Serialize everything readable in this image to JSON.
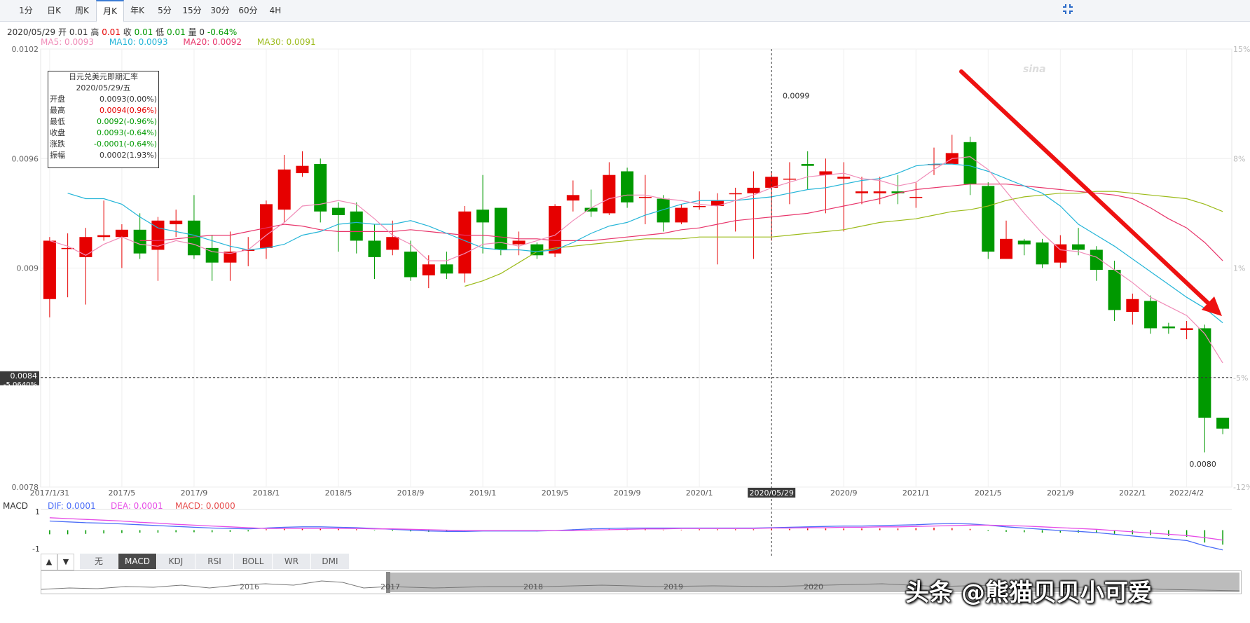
{
  "tabs": [
    "1分",
    "日K",
    "周K",
    "月K",
    "年K",
    "5分",
    "15分",
    "30分",
    "60分",
    "4H"
  ],
  "active_tab": "月K",
  "info": {
    "date": "2020/05/29",
    "open_label": "开",
    "open": "0.01",
    "high_label": "高",
    "high": "0.01",
    "close_label": "收",
    "close": "0.01",
    "low_label": "低",
    "low": "0.01",
    "vol_label": "量",
    "vol": "0",
    "change": "-0.64%"
  },
  "ma_legend": {
    "ma5": "MA5: 0.0093",
    "ma10": "MA10: 0.0093",
    "ma20": "MA20: 0.0092",
    "ma30": "MA30: 0.0091",
    "colors": {
      "ma5": "#f08cb8",
      "ma10": "#24b5d8",
      "ma20": "#e8356b",
      "ma30": "#9cbb1a"
    }
  },
  "tooltip": {
    "title": "日元兑美元即期汇率",
    "date": "2020/05/29/五",
    "rows": [
      {
        "k": "开盘",
        "v": "0.0093(0.00%)",
        "c": "#333333"
      },
      {
        "k": "最高",
        "v": "0.0094(0.96%)",
        "c": "#e60000"
      },
      {
        "k": "最低",
        "v": "0.0092(-0.96%)",
        "c": "#009900"
      },
      {
        "k": "收盘",
        "v": "0.0093(-0.64%)",
        "c": "#009900"
      },
      {
        "k": "涨跌",
        "v": "-0.0001(-0.64%)",
        "c": "#009900"
      },
      {
        "k": "振幅",
        "v": "0.0002(1.93%)",
        "c": "#333333"
      }
    ]
  },
  "crosshair": {
    "price": "0.0084",
    "pct": "-5.0640%",
    "date": "2020/05/29"
  },
  "annotations": {
    "max": "0.0099",
    "min": "0.0080"
  },
  "macd_legend": {
    "label": "MACD",
    "dif": "DIF: 0.0001",
    "dea": "DEA: 0.0001",
    "macd": "MACD: 0.0000",
    "top": "1",
    "bottom": "-1"
  },
  "indicator_tabs": [
    "无",
    "MACD",
    "KDJ",
    "RSI",
    "BOLL",
    "WR",
    "DMI"
  ],
  "active_indicator": "MACD",
  "arrows": {
    "up": "▲",
    "down": "▼"
  },
  "navigator_years": [
    "2016",
    "2017",
    "2018",
    "2019",
    "2020"
  ],
  "watermark": "头条 @熊猫贝贝小可爱",
  "chart_data": {
    "type": "candlestick",
    "title": "日元兑美元即期汇率",
    "ylim": [
      0.0078,
      0.0102
    ],
    "y_ticks": [
      "0.0102",
      "0.0096",
      "0.009",
      "0.0078"
    ],
    "pct_ticks": [
      "15%",
      "8%",
      "1%",
      "-5%",
      "-12%"
    ],
    "x_ticks": [
      "2017/1/31",
      "2017/5",
      "2017/9",
      "2018/1",
      "2018/5",
      "2018/9",
      "2019/1",
      "2019/5",
      "2019/9",
      "2020/1",
      "2020/9",
      "2021/1",
      "2021/5",
      "2021/9",
      "2022/1",
      "2022/4/2"
    ],
    "x_tick_index": [
      0,
      4,
      8,
      12,
      16,
      20,
      24,
      28,
      32,
      36,
      44,
      48,
      52,
      56,
      60,
      63
    ],
    "candles": [
      [
        0.00883,
        0.00915,
        0.00917,
        0.00873
      ],
      [
        0.00911,
        0.00911,
        0.00919,
        0.00884
      ],
      [
        0.00906,
        0.00917,
        0.00922,
        0.0088
      ],
      [
        0.00917,
        0.00918,
        0.00937,
        0.00915
      ],
      [
        0.00917,
        0.00921,
        0.00924,
        0.009
      ],
      [
        0.00921,
        0.00908,
        0.0093,
        0.00905
      ],
      [
        0.0091,
        0.00926,
        0.00928,
        0.00893
      ],
      [
        0.00924,
        0.00926,
        0.00932,
        0.00917
      ],
      [
        0.00926,
        0.00907,
        0.0094,
        0.00905
      ],
      [
        0.00911,
        0.00903,
        0.00918,
        0.00893
      ],
      [
        0.00903,
        0.00909,
        0.0092,
        0.00893
      ],
      [
        0.0091,
        0.0091,
        0.00917,
        0.00901
      ],
      [
        0.00911,
        0.00935,
        0.00937,
        0.00905
      ],
      [
        0.00932,
        0.00954,
        0.00962,
        0.00925
      ],
      [
        0.00952,
        0.00956,
        0.00964,
        0.0095
      ],
      [
        0.00957,
        0.00931,
        0.0096,
        0.00925
      ],
      [
        0.00933,
        0.00929,
        0.00936,
        0.00909
      ],
      [
        0.00931,
        0.00915,
        0.00936,
        0.00908
      ],
      [
        0.00915,
        0.00906,
        0.00924,
        0.00894
      ],
      [
        0.0091,
        0.00917,
        0.00926,
        0.00907
      ],
      [
        0.00909,
        0.00895,
        0.00915,
        0.00893
      ],
      [
        0.00896,
        0.00902,
        0.00907,
        0.00889
      ],
      [
        0.00902,
        0.00897,
        0.00909,
        0.00894
      ],
      [
        0.00897,
        0.00931,
        0.00934,
        0.00892
      ],
      [
        0.00932,
        0.00925,
        0.00951,
        0.00908
      ],
      [
        0.00933,
        0.0091,
        0.00933,
        0.00907
      ],
      [
        0.00913,
        0.00915,
        0.0092,
        0.00907
      ],
      [
        0.00913,
        0.00907,
        0.00914,
        0.00905
      ],
      [
        0.00908,
        0.00934,
        0.00935,
        0.00906
      ],
      [
        0.00937,
        0.0094,
        0.00948,
        0.00931
      ],
      [
        0.00933,
        0.00931,
        0.00943,
        0.00928
      ],
      [
        0.0093,
        0.00951,
        0.00958,
        0.00929
      ],
      [
        0.00953,
        0.00936,
        0.00955,
        0.00933
      ],
      [
        0.00939,
        0.00939,
        0.00951,
        0.00924
      ],
      [
        0.00938,
        0.00925,
        0.0094,
        0.0092
      ],
      [
        0.00925,
        0.00933,
        0.00935,
        0.00924
      ],
      [
        0.00934,
        0.00934,
        0.00942,
        0.00932
      ],
      [
        0.00934,
        0.00937,
        0.00941,
        0.00902
      ],
      [
        0.00941,
        0.00941,
        0.00944,
        0.0092
      ],
      [
        0.00941,
        0.00944,
        0.00953,
        0.00905
      ],
      [
        0.00944,
        0.0095,
        0.00953,
        0.00915
      ],
      [
        0.00949,
        0.00949,
        0.00958,
        0.00935
      ],
      [
        0.00957,
        0.00956,
        0.00964,
        0.00943
      ],
      [
        0.00951,
        0.00953,
        0.0096,
        0.0093
      ],
      [
        0.00949,
        0.0095,
        0.00958,
        0.0092
      ],
      [
        0.00941,
        0.00942,
        0.0095,
        0.00935
      ],
      [
        0.00941,
        0.00942,
        0.0095,
        0.00935
      ],
      [
        0.00942,
        0.00941,
        0.00951,
        0.00935
      ],
      [
        0.00939,
        0.00939,
        0.00947,
        0.00933
      ],
      [
        0.00957,
        0.00957,
        0.00966,
        0.00951
      ],
      [
        0.00957,
        0.00963,
        0.00973,
        0.00958
      ],
      [
        0.00969,
        0.00946,
        0.00972,
        0.0094
      ],
      [
        0.00945,
        0.00909,
        0.00947,
        0.00905
      ],
      [
        0.00905,
        0.00916,
        0.00926,
        0.00905
      ],
      [
        0.00915,
        0.00913,
        0.00916,
        0.00907
      ],
      [
        0.00914,
        0.00902,
        0.00916,
        0.009
      ],
      [
        0.00903,
        0.00913,
        0.00918,
        0.009
      ],
      [
        0.00913,
        0.0091,
        0.00922,
        0.00907
      ],
      [
        0.0091,
        0.00899,
        0.00912,
        0.00893
      ],
      [
        0.00899,
        0.00877,
        0.00904,
        0.00871
      ],
      [
        0.00876,
        0.00883,
        0.00886,
        0.00869
      ],
      [
        0.00882,
        0.00867,
        0.00885,
        0.00864
      ],
      [
        0.00868,
        0.00867,
        0.0087,
        0.00864
      ],
      [
        0.00866,
        0.00867,
        0.00871,
        0.00861
      ],
      [
        0.00867,
        0.00818,
        0.00869,
        0.00799
      ],
      [
        0.00818,
        0.00812,
        0.00818,
        0.00809
      ]
    ],
    "note": "candles are [open, close, high, low] for each month",
    "ma5": [
      0.00915,
      0.00912,
      0.00907,
      0.00913,
      0.00917,
      0.00913,
      0.00912,
      0.00915,
      0.00913,
      0.00909,
      0.00908,
      0.0091,
      0.00918,
      0.00925,
      0.00934,
      0.00935,
      0.00937,
      0.00935,
      0.00927,
      0.00918,
      0.00913,
      0.00904,
      0.00904,
      0.00908,
      0.00913,
      0.00914,
      0.00912,
      0.00915,
      0.00918,
      0.00926,
      0.00933,
      0.00938,
      0.0094,
      0.0094,
      0.00938,
      0.00937,
      0.00935,
      0.00934,
      0.00937,
      0.0094,
      0.00944,
      0.00947,
      0.0095,
      0.00951,
      0.00952,
      0.00949,
      0.00948,
      0.00945,
      0.00947,
      0.00954,
      0.0096,
      0.00961,
      0.00954,
      0.00942,
      0.0093,
      0.00919,
      0.0091,
      0.00909,
      0.00906,
      0.00899,
      0.00892,
      0.00884,
      0.00879,
      0.00874,
      0.00864,
      0.00848
    ],
    "ma10": [
      0.00941,
      0.00938,
      0.00938,
      0.00935,
      0.00928,
      0.00922,
      0.0092,
      0.00918,
      0.00915,
      0.00912,
      0.0091,
      0.00911,
      0.00913,
      0.00918,
      0.0092,
      0.00924,
      0.00925,
      0.00924,
      0.00924,
      0.00926,
      0.00923,
      0.00919,
      0.00915,
      0.00911,
      0.0091,
      0.0091,
      0.00909,
      0.0091,
      0.00914,
      0.00919,
      0.00923,
      0.00925,
      0.00929,
      0.00932,
      0.00935,
      0.00937,
      0.00937,
      0.00937,
      0.00938,
      0.00939,
      0.00941,
      0.00943,
      0.00944,
      0.00946,
      0.00948,
      0.00949,
      0.00952,
      0.00956,
      0.00957,
      0.00957,
      0.00956,
      0.00953,
      0.00949,
      0.00945,
      0.00941,
      0.00934,
      0.00924,
      0.00918,
      0.00912,
      0.00905,
      0.00898,
      0.00891,
      0.00884,
      0.00878,
      0.0087
    ],
    "ma20": [
      0.00915,
      0.00915,
      0.00916,
      0.00917,
      0.00918,
      0.00918,
      0.0092,
      0.00922,
      0.00924,
      0.00923,
      0.00921,
      0.0092,
      0.0092,
      0.0092,
      0.0092,
      0.00921,
      0.0092,
      0.00919,
      0.00918,
      0.00918,
      0.00917,
      0.00916,
      0.00916,
      0.00915,
      0.00915,
      0.00915,
      0.00916,
      0.00917,
      0.00918,
      0.00919,
      0.00921,
      0.00922,
      0.00924,
      0.00926,
      0.00927,
      0.00928,
      0.00929,
      0.0093,
      0.00932,
      0.00934,
      0.00936,
      0.00938,
      0.00941,
      0.00943,
      0.00944,
      0.00945,
      0.00946,
      0.00946,
      0.00946,
      0.00945,
      0.00944,
      0.00943,
      0.00942,
      0.00941,
      0.0094,
      0.00938,
      0.00933,
      0.00927,
      0.00922,
      0.00914,
      0.00904
    ],
    "ma30": [
      0.0089,
      0.00893,
      0.00897,
      0.00903,
      0.00909,
      0.00911,
      0.00912,
      0.00913,
      0.00914,
      0.00915,
      0.00916,
      0.00916,
      0.00916,
      0.00917,
      0.00917,
      0.00917,
      0.00917,
      0.00917,
      0.00918,
      0.00919,
      0.0092,
      0.00921,
      0.00923,
      0.00925,
      0.00926,
      0.00927,
      0.00929,
      0.00931,
      0.00932,
      0.00934,
      0.00937,
      0.00939,
      0.0094,
      0.00941,
      0.00941,
      0.00942,
      0.00942,
      0.00941,
      0.0094,
      0.00939,
      0.00938,
      0.00935,
      0.00931
    ],
    "macd_bars": [
      -0.1,
      -0.1,
      -0.09,
      -0.08,
      -0.07,
      -0.06,
      -0.06,
      -0.05,
      -0.05,
      -0.05,
      -0.04,
      -0.03,
      0.02,
      0.04,
      0.05,
      0.05,
      0.04,
      0.02,
      -0.01,
      -0.02,
      -0.03,
      -0.04,
      -0.04,
      -0.03,
      -0.01,
      -0.02,
      -0.02,
      -0.03,
      0.0,
      0.02,
      0.02,
      0.03,
      0.03,
      0.02,
      0.01,
      0.01,
      0.02,
      0.02,
      0.02,
      0.02,
      0.03,
      0.03,
      0.04,
      0.04,
      0.04,
      0.04,
      0.04,
      0.04,
      0.05,
      0.06,
      0.05,
      0.03,
      -0.02,
      -0.04,
      -0.05,
      -0.06,
      -0.06,
      -0.06,
      -0.07,
      -0.09,
      -0.1,
      -0.12,
      -0.14,
      -0.16,
      -0.3,
      -0.35
    ],
    "dif": [
      0.22,
      0.2,
      0.18,
      0.17,
      0.15,
      0.13,
      0.11,
      0.09,
      0.07,
      0.05,
      0.04,
      0.03,
      0.05,
      0.07,
      0.08,
      0.08,
      0.07,
      0.06,
      0.04,
      0.02,
      0.0,
      -0.02,
      -0.03,
      -0.03,
      -0.02,
      -0.02,
      -0.02,
      -0.02,
      -0.01,
      0.01,
      0.03,
      0.04,
      0.05,
      0.05,
      0.05,
      0.05,
      0.05,
      0.05,
      0.05,
      0.05,
      0.06,
      0.07,
      0.08,
      0.09,
      0.1,
      0.1,
      0.11,
      0.12,
      0.13,
      0.15,
      0.16,
      0.15,
      0.12,
      0.08,
      0.05,
      0.02,
      -0.01,
      -0.03,
      -0.06,
      -0.1,
      -0.14,
      -0.18,
      -0.21,
      -0.25,
      -0.38,
      -0.48
    ],
    "dea": [
      0.3,
      0.28,
      0.26,
      0.24,
      0.22,
      0.19,
      0.17,
      0.14,
      0.12,
      0.1,
      0.08,
      0.06,
      0.04,
      0.04,
      0.04,
      0.04,
      0.04,
      0.04,
      0.03,
      0.03,
      0.02,
      0.01,
      0.0,
      -0.01,
      -0.01,
      -0.01,
      -0.01,
      -0.01,
      -0.01,
      -0.01,
      0.0,
      0.01,
      0.02,
      0.03,
      0.03,
      0.04,
      0.04,
      0.04,
      0.04,
      0.04,
      0.05,
      0.05,
      0.06,
      0.06,
      0.07,
      0.07,
      0.08,
      0.08,
      0.09,
      0.1,
      0.11,
      0.12,
      0.12,
      0.11,
      0.1,
      0.08,
      0.06,
      0.04,
      0.02,
      -0.01,
      -0.04,
      -0.07,
      -0.1,
      -0.13,
      -0.18,
      -0.24
    ]
  }
}
